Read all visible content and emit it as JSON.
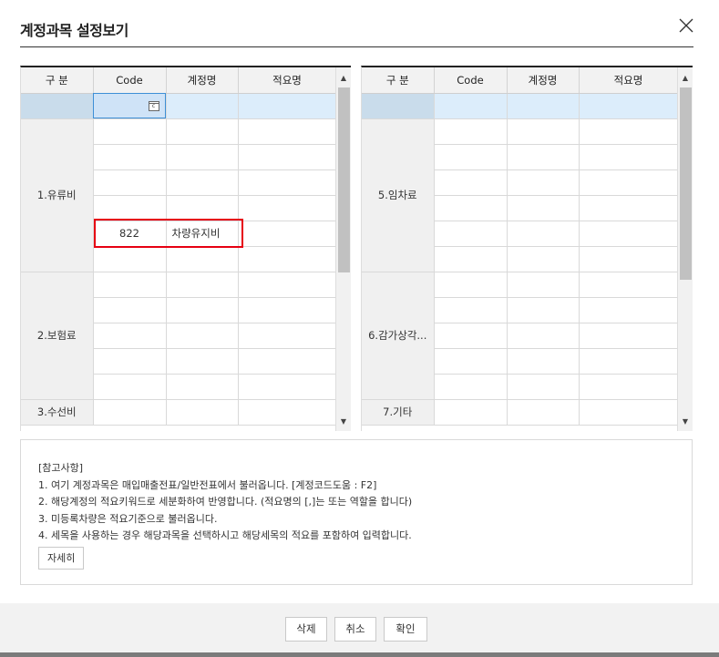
{
  "dialog": {
    "title": "계정과목 설정보기",
    "close_icon": "close-icon"
  },
  "columns": [
    "구 분",
    "Code",
    "계정명",
    "적요명"
  ],
  "left_table": {
    "groups": [
      {
        "label": "",
        "selected": true,
        "rows": [
          {
            "code": "",
            "name": "",
            "memo": ""
          }
        ]
      },
      {
        "label": "1.유류비",
        "rows": [
          {
            "code": "",
            "name": "",
            "memo": ""
          },
          {
            "code": "",
            "name": "",
            "memo": ""
          },
          {
            "code": "",
            "name": "",
            "memo": ""
          },
          {
            "code": "",
            "name": "",
            "memo": ""
          },
          {
            "code": "822",
            "name": "차량유지비",
            "memo": ""
          },
          {
            "code": "",
            "name": "",
            "memo": ""
          }
        ]
      },
      {
        "label": "2.보험료",
        "rows": [
          {
            "code": "",
            "name": "",
            "memo": ""
          },
          {
            "code": "",
            "name": "",
            "memo": ""
          },
          {
            "code": "",
            "name": "",
            "memo": ""
          },
          {
            "code": "",
            "name": "",
            "memo": ""
          },
          {
            "code": "",
            "name": "",
            "memo": ""
          }
        ]
      },
      {
        "label": "3.수선비",
        "rows": [
          {
            "code": "",
            "name": "",
            "memo": ""
          }
        ]
      }
    ],
    "scroll_position": 0.0
  },
  "right_table": {
    "groups": [
      {
        "label": "",
        "selected": true,
        "rows": [
          {
            "code": "",
            "name": "",
            "memo": ""
          }
        ]
      },
      {
        "label": "5.임차료",
        "rows": [
          {
            "code": "",
            "name": "",
            "memo": ""
          },
          {
            "code": "",
            "name": "",
            "memo": ""
          },
          {
            "code": "",
            "name": "",
            "memo": ""
          },
          {
            "code": "",
            "name": "",
            "memo": ""
          },
          {
            "code": "",
            "name": "",
            "memo": ""
          },
          {
            "code": "",
            "name": "",
            "memo": ""
          }
        ]
      },
      {
        "label": "6.감가상각...",
        "rows": [
          {
            "code": "",
            "name": "",
            "memo": ""
          },
          {
            "code": "",
            "name": "",
            "memo": ""
          },
          {
            "code": "",
            "name": "",
            "memo": ""
          },
          {
            "code": "",
            "name": "",
            "memo": ""
          },
          {
            "code": "",
            "name": "",
            "memo": ""
          }
        ]
      },
      {
        "label": "7.기타",
        "rows": [
          {
            "code": "",
            "name": "",
            "memo": ""
          }
        ]
      }
    ],
    "scroll_position": 0.0
  },
  "notes": {
    "title": "[참고사항]",
    "lines": [
      "1. 여기 계정과목은 매입매출전표/일반전표에서 불러옵니다. [계정코드도움 : F2]",
      "2. 해당계정의 적요키워드로 세분화하여 반영합니다. (적요명의 [,]는 또는 역할을 합니다)",
      "3. 미등록차량은 적요기준으로 불러옵니다.",
      "4. 세목을 사용하는 경우 해당과목을 선택하시고 해당세목의 적요를 포함하여 입력합니다."
    ],
    "detail_label": "자세히"
  },
  "buttons": {
    "delete": "삭제",
    "cancel": "취소",
    "confirm": "확인"
  },
  "colors": {
    "highlight_box": "#e60012",
    "selected_row": "#dcedfb",
    "focus_outline": "#3d8fd6"
  }
}
